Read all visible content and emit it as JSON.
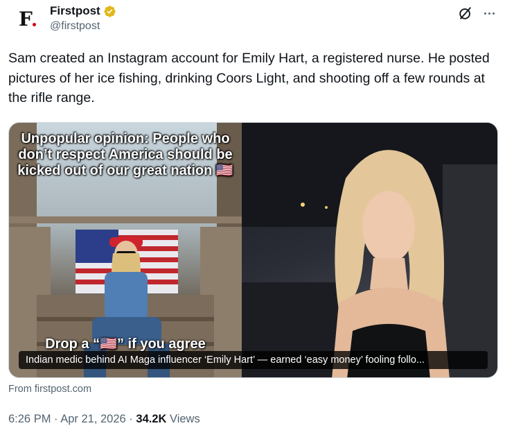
{
  "author": {
    "avatar_letter": "F",
    "display_name": "Firstpost",
    "handle": "@firstpost",
    "verified_color": "#e2b719"
  },
  "tweet": {
    "text": "Sam created an Instagram account for Emily Hart, a registered nurse. He posted pictures of her ice fishing, drinking Coors Light, and shooting off a few rounds at the rifle range."
  },
  "media": {
    "left_panel_text": "Unpopular opinion: People who don’t respect America should be kicked out of our great nation 🇺🇸",
    "left_panel_bottom_text": "Drop a “🇺🇸” if you agree",
    "caption": "Indian medic behind AI Maga influencer ‘Emily Hart’ — earned ‘easy money’ fooling follo..."
  },
  "card": {
    "source": "From firstpost.com"
  },
  "meta": {
    "time": "6:26 PM",
    "separator": " · ",
    "date": "Apr 21, 2026",
    "views_count": "34.2K",
    "views_label": " Views"
  },
  "colors": {
    "text": "#0f1419",
    "secondary": "#536471",
    "border": "#cfd9de",
    "brand_dot": "#d0021b"
  }
}
